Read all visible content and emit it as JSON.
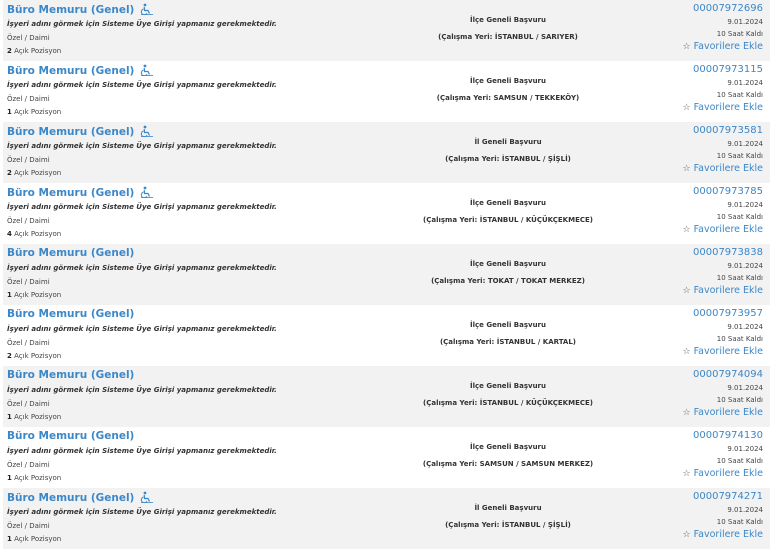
{
  "listings": [
    {
      "title": "Büro Memuru (Genel)",
      "has_icon": true,
      "login_note": "İşyeri adını görmek için Sisteme Üye Girişi yapmanız gerekmektedir.",
      "work_type": "Özel / Daimi",
      "positions_count": "2",
      "positions_label": "Açık Pozisyon",
      "scope": "İlçe Geneli Başvuru",
      "location": "(Çalışma Yeri: İSTANBUL / SARIYER)",
      "ilan_no": "00007972696",
      "date": "9.01.2024",
      "time_left": "10 Saat Kaldı",
      "favorite_label": "Favorilere Ekle"
    },
    {
      "title": "Büro Memuru (Genel)",
      "has_icon": true,
      "login_note": "İşyeri adını görmek için Sisteme Üye Girişi yapmanız gerekmektedir.",
      "work_type": "Özel / Daimi",
      "positions_count": "1",
      "positions_label": "Açık Pozisyon",
      "scope": "İlçe Geneli Başvuru",
      "location": "(Çalışma Yeri: SAMSUN / TEKKEKÖY)",
      "ilan_no": "00007973115",
      "date": "9.01.2024",
      "time_left": "10 Saat Kaldı",
      "favorite_label": "Favorilere Ekle"
    },
    {
      "title": "Büro Memuru (Genel)",
      "has_icon": true,
      "login_note": "İşyeri adını görmek için Sisteme Üye Girişi yapmanız gerekmektedir.",
      "work_type": "Özel / Daimi",
      "positions_count": "2",
      "positions_label": "Açık Pozisyon",
      "scope": "İl Geneli Başvuru",
      "location": "(Çalışma Yeri: İSTANBUL / ŞİŞLİ)",
      "ilan_no": "00007973581",
      "date": "9.01.2024",
      "time_left": "10 Saat Kaldı",
      "favorite_label": "Favorilere Ekle"
    },
    {
      "title": "Büro Memuru (Genel)",
      "has_icon": true,
      "login_note": "İşyeri adını görmek için Sisteme Üye Girişi yapmanız gerekmektedir.",
      "work_type": "Özel / Daimi",
      "positions_count": "4",
      "positions_label": "Açık Pozisyon",
      "scope": "İlçe Geneli Başvuru",
      "location": "(Çalışma Yeri: İSTANBUL / KÜÇÜKÇEKMECE)",
      "ilan_no": "00007973785",
      "date": "9.01.2024",
      "time_left": "10 Saat Kaldı",
      "favorite_label": "Favorilere Ekle"
    },
    {
      "title": "Büro Memuru (Genel)",
      "has_icon": false,
      "login_note": "İşyeri adını görmek için Sisteme Üye Girişi yapmanız gerekmektedir.",
      "work_type": "Özel / Daimi",
      "positions_count": "1",
      "positions_label": "Açık Pozisyon",
      "scope": "İlçe Geneli Başvuru",
      "location": "(Çalışma Yeri: TOKAT / TOKAT MERKEZ)",
      "ilan_no": "00007973838",
      "date": "9.01.2024",
      "time_left": "10 Saat Kaldı",
      "favorite_label": "Favorilere Ekle"
    },
    {
      "title": "Büro Memuru (Genel)",
      "has_icon": false,
      "login_note": "İşyeri adını görmek için Sisteme Üye Girişi yapmanız gerekmektedir.",
      "work_type": "Özel / Daimi",
      "positions_count": "2",
      "positions_label": "Açık Pozisyon",
      "scope": "İlçe Geneli Başvuru",
      "location": "(Çalışma Yeri: İSTANBUL / KARTAL)",
      "ilan_no": "00007973957",
      "date": "9.01.2024",
      "time_left": "10 Saat Kaldı",
      "favorite_label": "Favorilere Ekle"
    },
    {
      "title": "Büro Memuru (Genel)",
      "has_icon": false,
      "login_note": "İşyeri adını görmek için Sisteme Üye Girişi yapmanız gerekmektedir.",
      "work_type": "Özel / Daimi",
      "positions_count": "1",
      "positions_label": "Açık Pozisyon",
      "scope": "İlçe Geneli Başvuru",
      "location": "(Çalışma Yeri: İSTANBUL / KÜÇÜKÇEKMECE)",
      "ilan_no": "00007974094",
      "date": "9.01.2024",
      "time_left": "10 Saat Kaldı",
      "favorite_label": "Favorilere Ekle"
    },
    {
      "title": "Büro Memuru (Genel)",
      "has_icon": false,
      "login_note": "İşyeri adını görmek için Sisteme Üye Girişi yapmanız gerekmektedir.",
      "work_type": "Özel / Daimi",
      "positions_count": "1",
      "positions_label": "Açık Pozisyon",
      "scope": "İlçe Geneli Başvuru",
      "location": "(Çalışma Yeri: SAMSUN / SAMSUN MERKEZ)",
      "ilan_no": "00007974130",
      "date": "9.01.2024",
      "time_left": "10 Saat Kaldı",
      "favorite_label": "Favorilere Ekle"
    },
    {
      "title": "Büro Memuru (Genel)",
      "has_icon": true,
      "login_note": "İşyeri adını görmek için Sisteme Üye Girişi yapmanız gerekmektedir.",
      "work_type": "Özel / Daimi",
      "positions_count": "1",
      "positions_label": "Açık Pozisyon",
      "scope": "İl Geneli Başvuru",
      "location": "(Çalışma Yeri: İSTANBUL / ŞİŞLİ)",
      "ilan_no": "00007974271",
      "date": "9.01.2024",
      "time_left": "10 Saat Kaldı",
      "favorite_label": "Favorilere Ekle"
    }
  ],
  "colors": {
    "link": "#3c87c8",
    "row_alt": "#f2f2f2"
  },
  "icons": {
    "title_icon": "disabled-person-icon",
    "favorite_icon": "star-icon"
  }
}
